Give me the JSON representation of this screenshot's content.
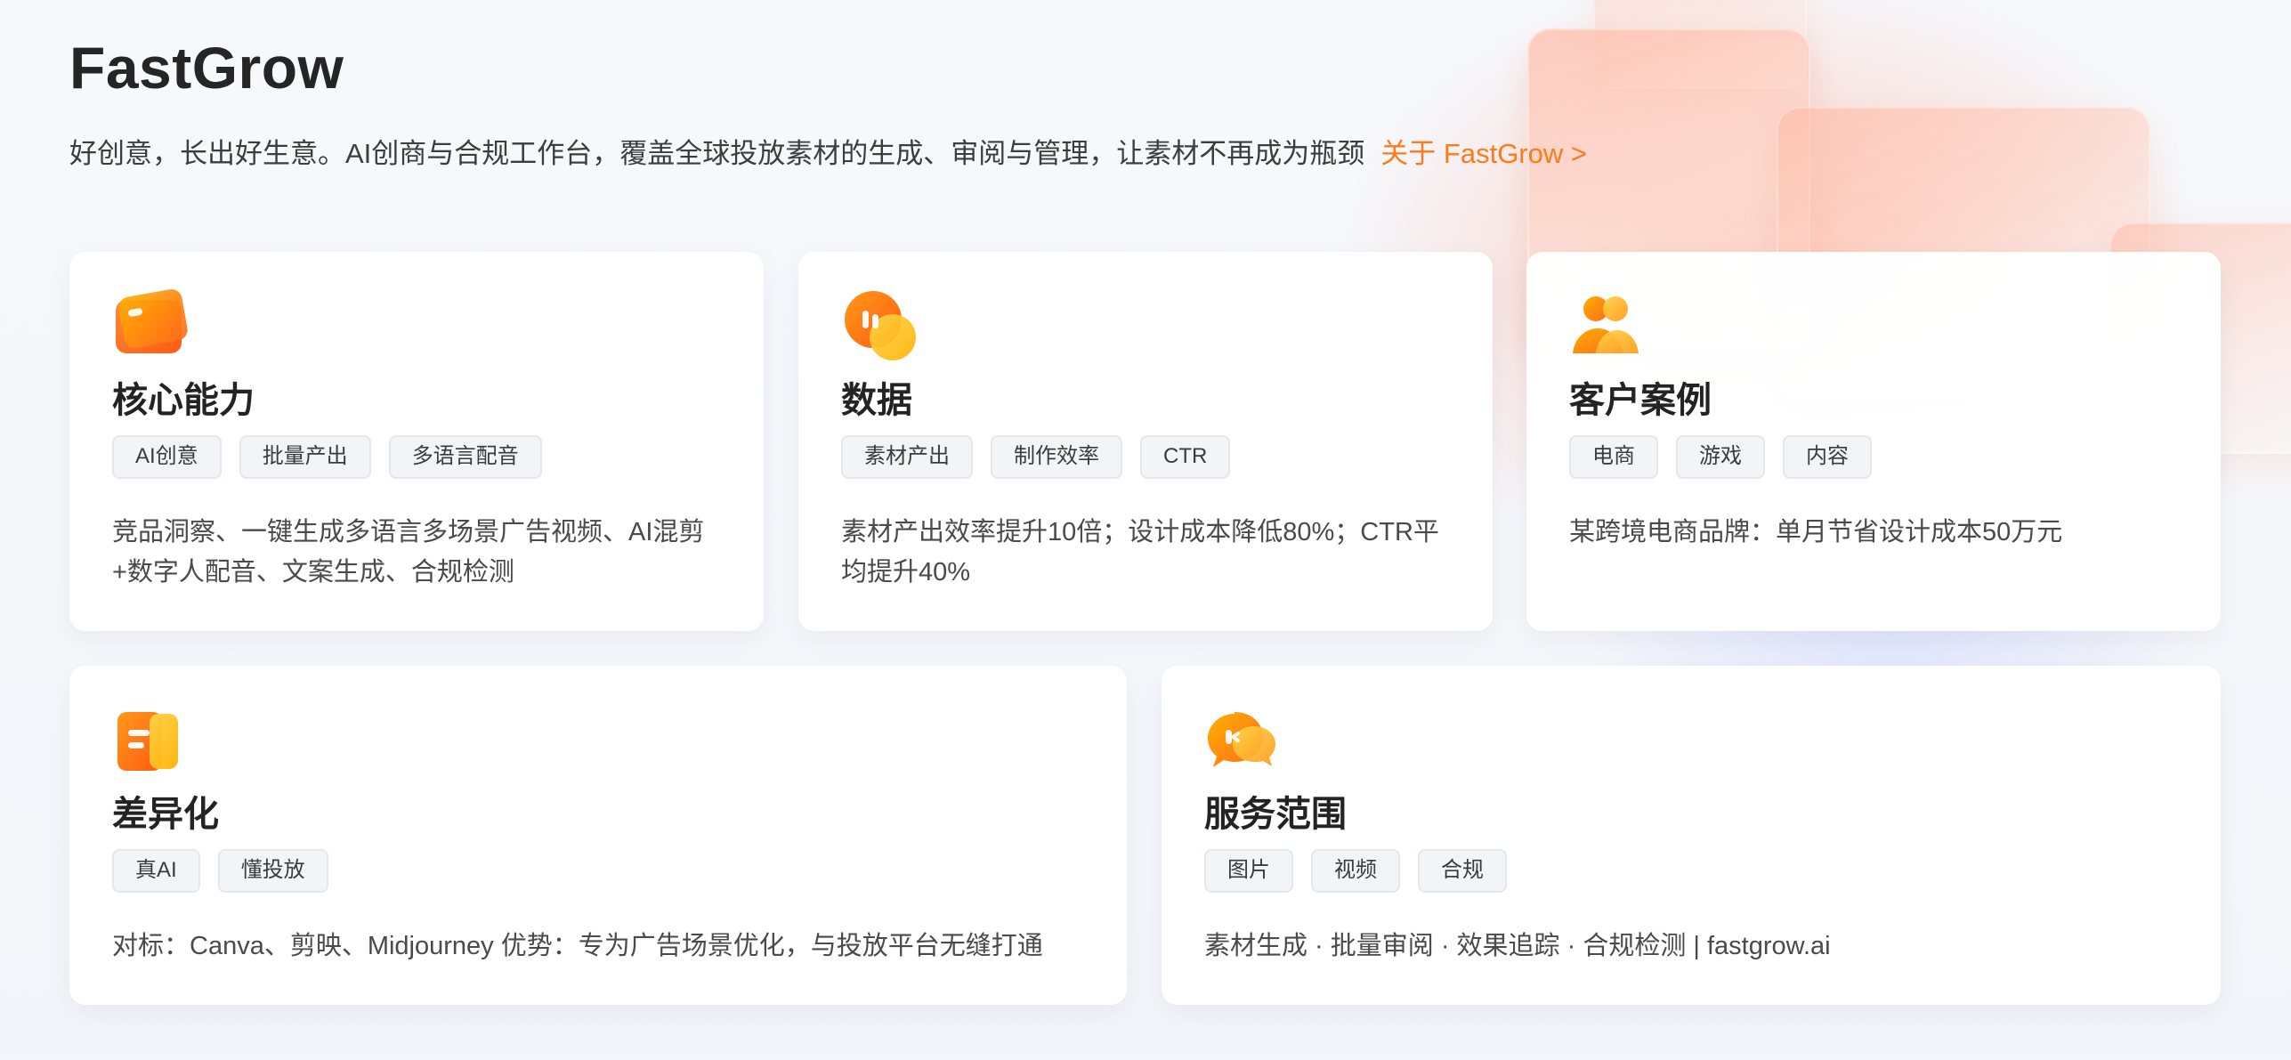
{
  "header": {
    "title": "FastGrow",
    "subtitle": "好创意，长出好生意。AI创商与合规工作台，覆盖全球投放素材的生成、审阅与管理，让素材不再成为瓶颈",
    "about_link": "关于 FastGrow >"
  },
  "colors": {
    "accent": "#ff7a1a",
    "text": "#2b2b2b",
    "muted": "#4a4a4a",
    "tag_bg": "#f3f4f7",
    "tag_border": "#e5e7ee"
  },
  "cards": [
    {
      "icon": "card-icon",
      "title": "核心能力",
      "tags": [
        "AI创意",
        "批量产出",
        "多语言配音"
      ],
      "description": "竞品洞察、一键生成多语言多场景广告视频、AI混剪+数字人配音、文案生成、合规检测"
    },
    {
      "icon": "data-icon",
      "title": "数据",
      "tags": [
        "素材产出",
        "制作效率",
        "CTR"
      ],
      "description": "素材产出效率提升10倍；设计成本降低80%；CTR平均提升40%"
    },
    {
      "icon": "users-icon",
      "title": "客户案例",
      "tags": [
        "电商",
        "游戏",
        "内容"
      ],
      "description": "某跨境电商品牌：单月节省设计成本50万元"
    },
    {
      "icon": "document-icon",
      "title": "差异化",
      "tags": [
        "真AI",
        "懂投放"
      ],
      "description": "对标：Canva、剪映、Midjourney 优势：专为广告场景优化，与投放平台无缝打通"
    },
    {
      "icon": "chat-icon",
      "title": "服务范围",
      "tags": [
        "图片",
        "视频",
        "合规"
      ],
      "description": "素材生成 · 批量审阅 · 效果追踪 · 合规检测 | fastgrow.ai"
    }
  ]
}
